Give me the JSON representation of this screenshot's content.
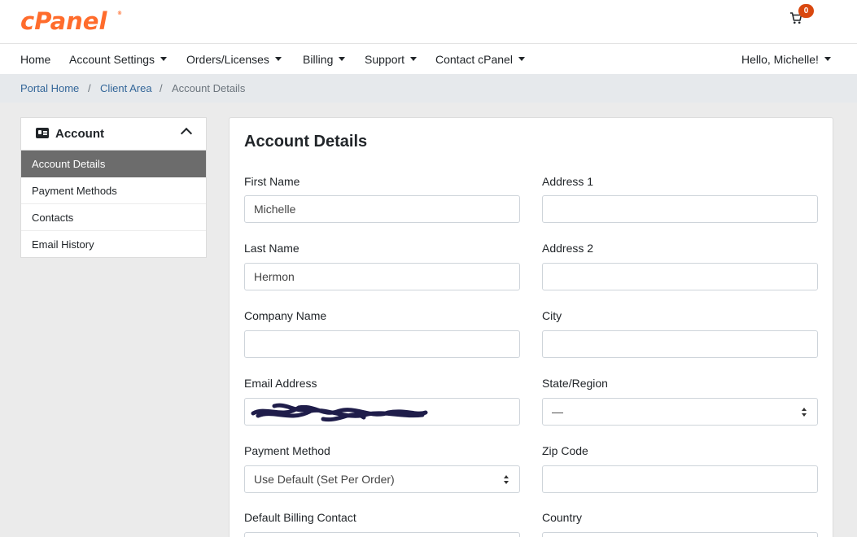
{
  "brand": {
    "logo_text": "cPanel",
    "accent_color": "#ff6c2c"
  },
  "cart": {
    "count": "0",
    "icon": "shopping-cart-icon"
  },
  "nav": {
    "items": [
      {
        "label": "Home"
      },
      {
        "label": "Account Settings"
      },
      {
        "label": "Orders/Licenses"
      },
      {
        "label": "Billing"
      },
      {
        "label": "Support"
      },
      {
        "label": "Contact cPanel"
      }
    ],
    "user_greeting": "Hello, Michelle!"
  },
  "breadcrumb": {
    "items": [
      "Portal Home",
      "Client Area",
      "Account Details"
    ],
    "separator": "/"
  },
  "sidebar": {
    "title": "Account",
    "icon": "address-card-icon",
    "items": [
      {
        "label": "Account Details",
        "active": true
      },
      {
        "label": "Payment Methods"
      },
      {
        "label": "Contacts"
      },
      {
        "label": "Email History"
      }
    ]
  },
  "form": {
    "title": "Account Details",
    "first_name": {
      "label": "First Name",
      "value": "Michelle"
    },
    "last_name": {
      "label": "Last Name",
      "value": "Hermon"
    },
    "company_name": {
      "label": "Company Name",
      "value": ""
    },
    "email": {
      "label": "Email Address",
      "value": ""
    },
    "payment_method": {
      "label": "Payment Method",
      "value": "Use Default (Set Per Order)"
    },
    "default_billing_contact": {
      "label": "Default Billing Contact",
      "value": ""
    },
    "address1": {
      "label": "Address 1",
      "value": ""
    },
    "address2": {
      "label": "Address 2",
      "value": ""
    },
    "city": {
      "label": "City",
      "value": ""
    },
    "state": {
      "label": "State/Region",
      "value": "—"
    },
    "zip": {
      "label": "Zip Code",
      "value": ""
    },
    "country": {
      "label": "Country",
      "value": ""
    }
  }
}
